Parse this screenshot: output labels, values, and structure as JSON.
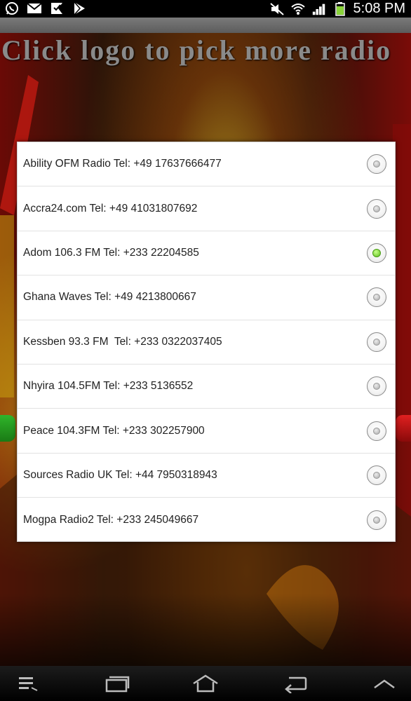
{
  "status_bar": {
    "time": "5:08 PM",
    "left_icons": [
      "whatsapp-icon",
      "mail-icon",
      "download-icon",
      "play-store-icon"
    ],
    "right_icons": [
      "mute-icon",
      "wifi-icon",
      "signal-icon",
      "battery-icon"
    ]
  },
  "header": {
    "text": "Click logo to pick more radio"
  },
  "dialog": {
    "items": [
      {
        "label": "Ability OFM Radio Tel: +49 17637666477",
        "selected": false
      },
      {
        "label": "Accra24.com Tel: +49 41031807692",
        "selected": false
      },
      {
        "label": "Adom 106.3 FM Tel: +233 22204585",
        "selected": true
      },
      {
        "label": "Ghana Waves Tel: +49 4213800667",
        "selected": false
      },
      {
        "label": "Kessben 93.3 FM  Tel: +233 0322037405",
        "selected": false
      },
      {
        "label": "Nhyira 104.5FM Tel: +233 5136552",
        "selected": false
      },
      {
        "label": "Peace 104.3FM Tel: +233 302257900",
        "selected": false
      },
      {
        "label": "Sources Radio UK Tel: +44 7950318943",
        "selected": false
      },
      {
        "label": "Mogpa Radio2 Tel: +233 245049667",
        "selected": false
      }
    ]
  },
  "nav_bar": {
    "buttons": [
      "menu-icon",
      "recent-apps-icon",
      "home-icon",
      "back-icon",
      "up-chevron-icon"
    ]
  },
  "colors": {
    "selected_radio": "#5cbf1a",
    "dialog_bg": "#ffffff",
    "header_text": "#8a8a8a"
  }
}
